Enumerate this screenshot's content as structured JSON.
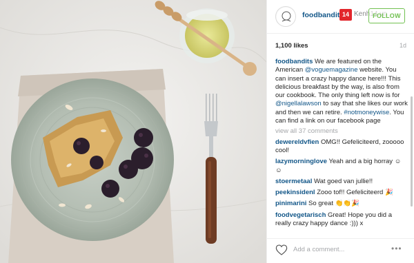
{
  "header": {
    "username": "foodbandits",
    "follow_label": "FOLLOW",
    "watermark_number": "14",
    "watermark_text": "Kenh14.vn"
  },
  "stats": {
    "likes": "1,100 likes",
    "age": "1d"
  },
  "caption": {
    "username": "foodbandits",
    "part1": " We are featured on the American ",
    "mention1": "@voguemagazine",
    "part2": " website. You can insert a crazy happy dance here!!! This delicious breakfast by the way, is also from our cookbook. The only thing left now is for ",
    "mention2": "@nigellalawson",
    "part3": " to say that she likes our work and then we can retire. ",
    "hashtag": "#notmoneywise",
    "part4": ". You can find a link on our facebook page"
  },
  "view_all": "view all 37 comments",
  "comments": [
    {
      "user": "dewereldvfien",
      "text": "OMG!! Gefeliciteerd, zooooo cool!"
    },
    {
      "user": "lazymorninglove",
      "text": "Yeah and a big horray ☺☺"
    },
    {
      "user": "stoermetaal",
      "text": "Wat goed van jullie!!"
    },
    {
      "user": "peekinsidenl",
      "text": "Zooo tof!! Gefeliciteerd 🎉"
    },
    {
      "user": "pinimarini",
      "text": "So great 👏👏🎉"
    },
    {
      "user": "foodvegetarisch",
      "text": "Great! Hope you did a really crazy happy dance :))) x"
    }
  ],
  "footer": {
    "comment_placeholder": "Add a comment...",
    "more_label": "•••"
  },
  "icons": {
    "like": "heart-icon",
    "more": "more-options-icon"
  },
  "colors": {
    "username_link": "#125688",
    "follow_green": "#70c050",
    "muted": "#a5a7aa",
    "watermark_red": "#e2262c"
  }
}
